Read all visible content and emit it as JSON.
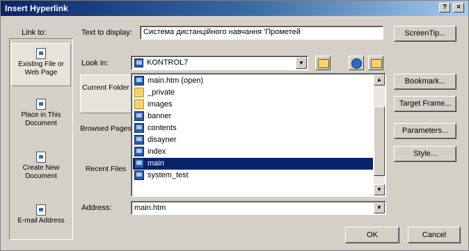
{
  "window": {
    "title": "Insert Hyperlink",
    "help_label": "?",
    "close_label": "×"
  },
  "link_to": {
    "label": "Link to:",
    "items": [
      {
        "label": "Existing File or Web Page"
      },
      {
        "label": "Place in This Document"
      },
      {
        "label": "Create New Document"
      },
      {
        "label": "E-mail Address"
      }
    ]
  },
  "text_to_display": {
    "label": "Text to display:",
    "value": "Система дистанційного навчання 'Прометей"
  },
  "buttons": {
    "screentip": "ScreenTip...",
    "bookmark": "Bookmark...",
    "target_frame": "Target Frame...",
    "parameters": "Parameters...",
    "style": "Style...",
    "ok": "OK",
    "cancel": "Cancel"
  },
  "look_in": {
    "label": "Look in:",
    "value": "KONTROL7"
  },
  "places": {
    "current_folder": "Current Folder",
    "browsed_pages": "Browsed Pages",
    "recent_files": "Recent Files"
  },
  "files": [
    {
      "name": "main.htm (open)",
      "icon": "web-page-icon"
    },
    {
      "name": "_private",
      "icon": "folder-icon"
    },
    {
      "name": "images",
      "icon": "folder-icon"
    },
    {
      "name": "banner",
      "icon": "web-page-icon"
    },
    {
      "name": "contents",
      "icon": "web-page-icon"
    },
    {
      "name": "disayner",
      "icon": "web-page-icon"
    },
    {
      "name": "index",
      "icon": "web-page-icon"
    },
    {
      "name": "main",
      "icon": "web-page-icon",
      "selected": true
    },
    {
      "name": "system_test",
      "icon": "web-page-icon"
    }
  ],
  "address": {
    "label": "Address:",
    "value": "main.htm"
  },
  "colors": {
    "title_start": "#0a246a",
    "selection": "#0a246a",
    "face": "#d4d0c8"
  }
}
